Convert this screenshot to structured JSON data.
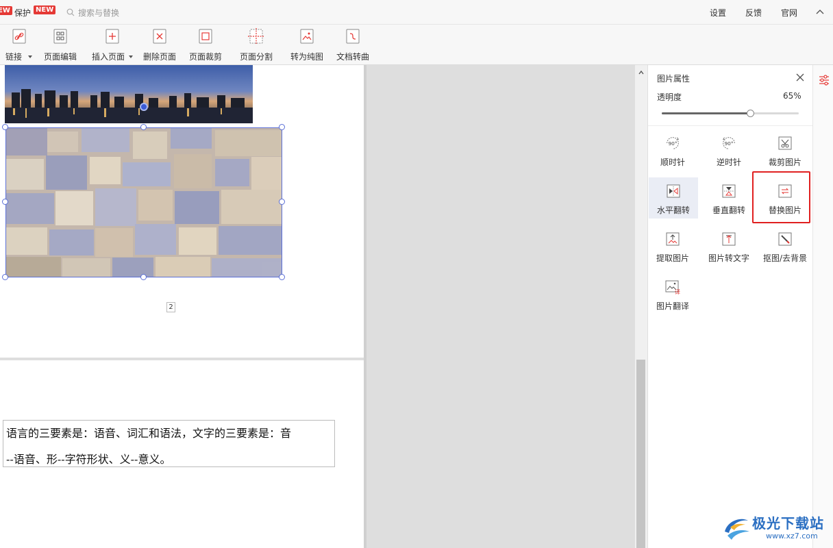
{
  "topbar": {
    "new_left": "EW",
    "protect": "保护",
    "new_badge": "NEW",
    "search_placeholder": "搜索与替换",
    "settings": "设置",
    "feedback": "反馈",
    "website": "官网"
  },
  "toolbar": {
    "items": [
      {
        "label": "链接",
        "icon": "link-icon"
      },
      {
        "label": "页面编辑",
        "icon": "page-edit-icon"
      },
      {
        "label": "插入页面",
        "icon": "insert-page-icon"
      },
      {
        "label": "删除页面",
        "icon": "delete-page-icon"
      },
      {
        "label": "页面裁剪",
        "icon": "page-crop-icon"
      },
      {
        "label": "页面分割",
        "icon": "page-split-icon"
      },
      {
        "label": "转为纯图",
        "icon": "to-image-icon"
      },
      {
        "label": "文档转曲",
        "icon": "doc-curve-icon"
      }
    ]
  },
  "document": {
    "page_number": "2",
    "text_line1": "语言的三要素是：语音、词汇和语法，文字的三要素是：音",
    "text_line2": "--语音、形--字符形状、义--意义。"
  },
  "panel": {
    "title": "图片属性",
    "opacity_label": "透明度",
    "opacity_value": "65%",
    "opacity_fraction": 0.65,
    "buttons": [
      {
        "label": "顺时针",
        "icon": "rotate-clockwise-icon"
      },
      {
        "label": "逆时针",
        "icon": "rotate-counterclockwise-icon"
      },
      {
        "label": "裁剪图片",
        "icon": "crop-image-icon"
      },
      {
        "label": "水平翻转",
        "icon": "flip-horizontal-icon"
      },
      {
        "label": "垂直翻转",
        "icon": "flip-vertical-icon"
      },
      {
        "label": "替换图片",
        "icon": "replace-image-icon"
      },
      {
        "label": "提取图片",
        "icon": "extract-image-icon"
      },
      {
        "label": "图片转文字",
        "icon": "image-to-text-icon"
      },
      {
        "label": "抠图/去背景",
        "icon": "remove-background-icon"
      },
      {
        "label": "图片翻译",
        "icon": "image-translate-icon"
      }
    ],
    "rotate_badge": "90°",
    "translate_badge": "译"
  },
  "watermark": {
    "text": "极光下载站",
    "url": "www.xz7.com"
  },
  "colors": {
    "accent_red": "#e53935",
    "highlight_red": "#e02020",
    "selection_blue": "#5b6fd6",
    "watermark_blue": "#2b6fc2"
  }
}
